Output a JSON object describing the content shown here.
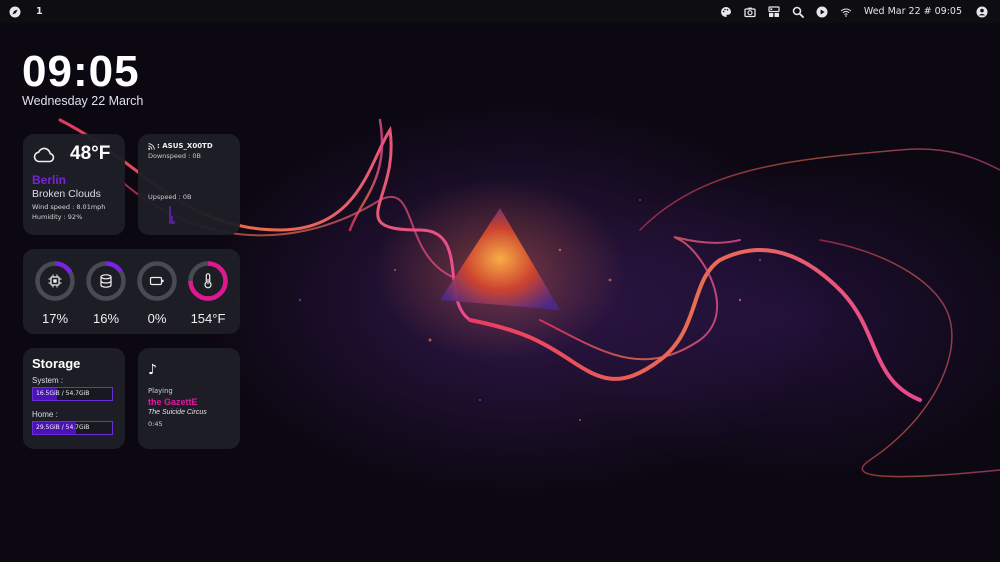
{
  "topbar": {
    "workspace": "1",
    "clock": "Wed Mar 22 # 09:05",
    "icons": [
      "compass-icon",
      "palette-icon",
      "camera-icon",
      "dashboard-icon",
      "search-icon",
      "play-icon",
      "wifi-icon",
      "user-icon"
    ]
  },
  "clock": {
    "time": "09:05",
    "date": "Wednesday 22 March"
  },
  "weather": {
    "icon": "cloud-icon",
    "temp": "48°F",
    "city": "Berlin",
    "condition": "Broken Clouds",
    "wind": "Wind speed : 8.01mph",
    "humidity": "Humidity : 92%"
  },
  "network": {
    "icon": "rss-icon",
    "ssid": ": ASUS_X00TD",
    "downspeed": "Downspeed : 0B",
    "upspeed": "Upspeed : 0B"
  },
  "stats": {
    "cpu": {
      "icon": "cpu-icon",
      "label": "17%",
      "fraction": 0.17,
      "color": "#7b22e0"
    },
    "ram": {
      "icon": "database-icon",
      "label": "16%",
      "fraction": 0.16,
      "color": "#7b22e0"
    },
    "battery": {
      "icon": "battery-icon",
      "label": "0%",
      "fraction": 0.0,
      "color": "#7b22e0"
    },
    "temp": {
      "icon": "thermometer-icon",
      "label": "154°F",
      "fraction": 0.75,
      "color": "#e0178f"
    }
  },
  "storage": {
    "title": "Storage",
    "system_label": "System :",
    "system_value": "16.5GiB / 54.7GiB",
    "system_fraction": 0.3,
    "home_label": "Home :",
    "home_value": "29.5GiB / 54.7GiB",
    "home_fraction": 0.54
  },
  "music": {
    "icon": "music-note-icon",
    "status": "Playing",
    "artist": "the GazettE",
    "song": "The Suicide Circus",
    "time": "0:45"
  },
  "colors": {
    "accent_purple": "#7b22e0",
    "accent_pink": "#e0178f",
    "card_bg": "#1e1f26",
    "ring_track": "#4a4b52"
  }
}
